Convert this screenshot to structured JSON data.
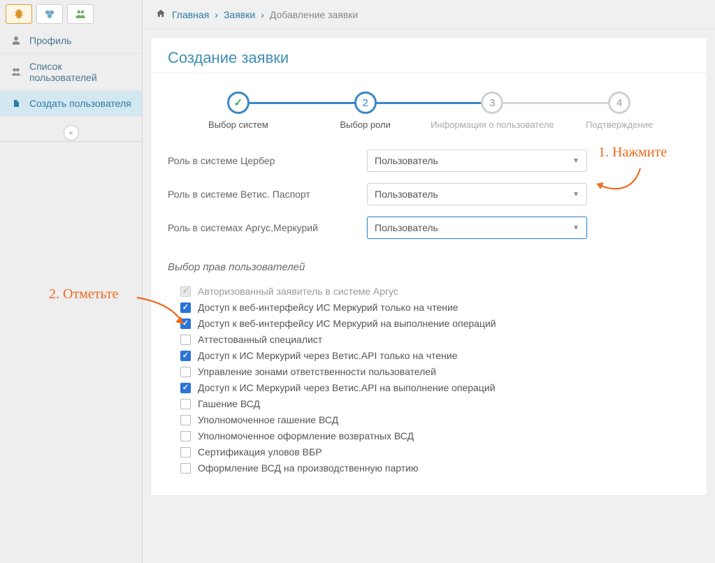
{
  "sidebar": {
    "items": [
      {
        "label": "Профиль",
        "icon": "user"
      },
      {
        "label": "Список пользователей",
        "icon": "users"
      },
      {
        "label": "Создать пользователя",
        "icon": "file"
      }
    ]
  },
  "breadcrumb": {
    "home": "Главная",
    "mid": "Заявки",
    "last": "Добавление заявки"
  },
  "panel": {
    "title": "Создание заявки"
  },
  "steps": [
    {
      "label": "Выбор систем",
      "state": "done",
      "mark": "✓"
    },
    {
      "label": "Выбор роли",
      "state": "current",
      "mark": "2"
    },
    {
      "label": "Информация о пользователе",
      "state": "inactive",
      "mark": "3"
    },
    {
      "label": "Подтверждение",
      "state": "inactive",
      "mark": "4"
    }
  ],
  "roles": [
    {
      "label": "Роль в системе Цербер",
      "value": "Пользователь",
      "highlight": false
    },
    {
      "label": "Роль в системе Ветис. Паспорт",
      "value": "Пользователь",
      "highlight": false
    },
    {
      "label": "Роль в системах Аргус,Меркурий",
      "value": "Пользователь",
      "highlight": true
    }
  ],
  "perm_section_title": "Выбор прав пользователей",
  "permissions": [
    {
      "label": "Авторизованный заявитель в системе Аргус",
      "checked": true,
      "disabled": true
    },
    {
      "label": "Доступ к веб-интерфейсу ИС Меркурий только на чтение",
      "checked": true,
      "disabled": false
    },
    {
      "label": "Доступ к веб-интерфейсу ИС Меркурий на выполнение операций",
      "checked": true,
      "disabled": false
    },
    {
      "label": "Аттестованный специалист",
      "checked": false,
      "disabled": false
    },
    {
      "label": "Доступ к ИС Меркурий через Ветис.API только на чтение",
      "checked": true,
      "disabled": false
    },
    {
      "label": "Управление зонами ответственности пользователей",
      "checked": false,
      "disabled": false
    },
    {
      "label": "Доступ к ИС Меркурий через Ветис.API на выполнение операций",
      "checked": true,
      "disabled": false
    },
    {
      "label": "Гашение ВСД",
      "checked": false,
      "disabled": false
    },
    {
      "label": "Уполномоченное гашение ВСД",
      "checked": false,
      "disabled": false
    },
    {
      "label": "Уполномоченное оформление возвратных ВСД",
      "checked": false,
      "disabled": false
    },
    {
      "label": "Сертификация уловов ВБР",
      "checked": false,
      "disabled": false
    },
    {
      "label": "Оформление ВСД на производственную партию",
      "checked": false,
      "disabled": false
    }
  ],
  "annotations": {
    "one": "1. Нажмите",
    "two": "2. Отметьте"
  }
}
